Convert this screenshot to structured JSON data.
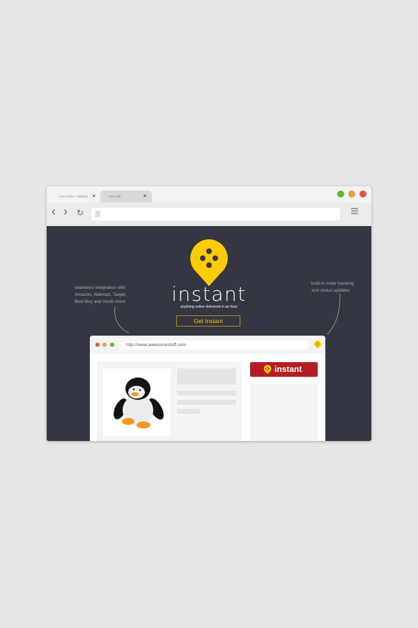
{
  "browser": {
    "tabs": [
      {
        "label": "Cos Author • WebKit"
      },
      {
        "label": "New Tab"
      }
    ],
    "close_glyph": "×",
    "window_controls": {
      "colors": [
        "#5bb833",
        "#e2a53c",
        "#e0564b"
      ]
    },
    "back_glyph": "‹",
    "forward_glyph": "›",
    "reload_glyph": "↻",
    "menu_glyph": "≡"
  },
  "hero": {
    "left_note": [
      "seamless integration with",
      "Amazon, Walmart, Target,",
      "Best Buy and much more"
    ],
    "right_note": [
      "built-in order tracking",
      "and status updates"
    ],
    "brand": "instant",
    "tagline": "anything online delivered in an hour",
    "cta_label": "Get Instant",
    "brand_color": "#ffcc00"
  },
  "demo_browser": {
    "url": "http://www.awesomestuff.com",
    "button_label": "instant",
    "button_color": "#b51d24"
  }
}
